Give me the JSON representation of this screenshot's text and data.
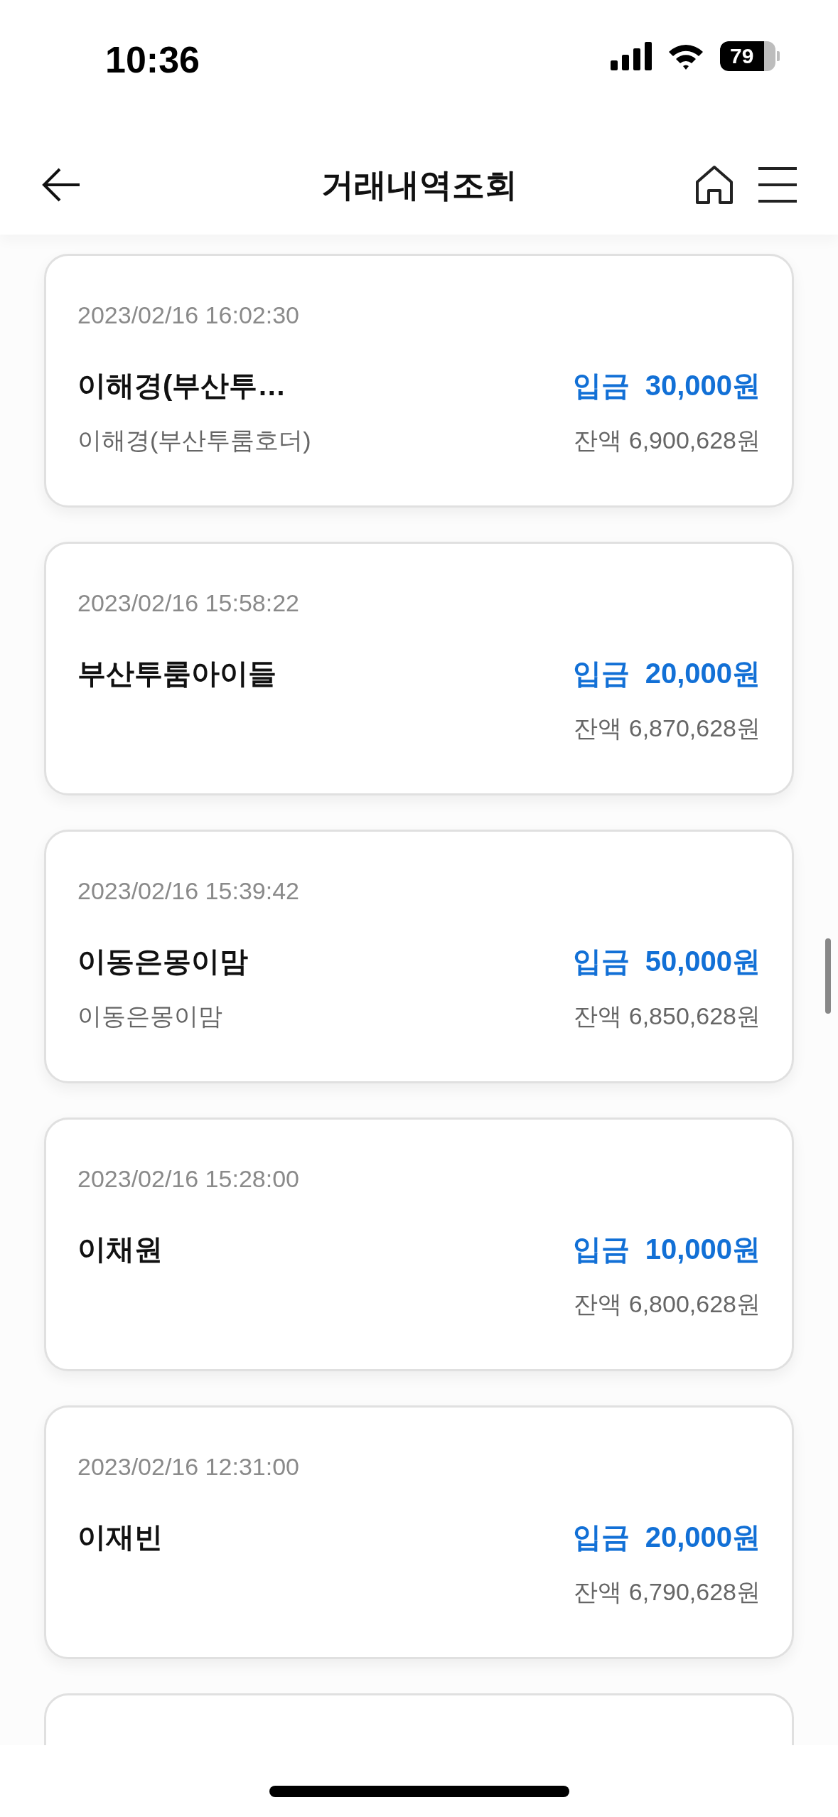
{
  "status_bar": {
    "time": "10:36",
    "battery": "79"
  },
  "header": {
    "title": "거래내역조회"
  },
  "transactions": [
    {
      "datetime": "2023/02/16 16:02:30",
      "name": "이해경(부산투…",
      "type": "입금",
      "amount": "30,000원",
      "memo": "이해경(부산투룸호더)",
      "balance": "잔액 6,900,628원"
    },
    {
      "datetime": "2023/02/16 15:58:22",
      "name": "부산투룸아이들",
      "type": "입금",
      "amount": "20,000원",
      "balance": "잔액 6,870,628원"
    },
    {
      "datetime": "2023/02/16 15:39:42",
      "name": "이동은몽이맘",
      "type": "입금",
      "amount": "50,000원",
      "memo": "이동은몽이맘",
      "balance": "잔액 6,850,628원"
    },
    {
      "datetime": "2023/02/16 15:28:00",
      "name": "이채원",
      "type": "입금",
      "amount": "10,000원",
      "balance": "잔액 6,800,628원"
    },
    {
      "datetime": "2023/02/16 12:31:00",
      "name": "이재빈",
      "type": "입금",
      "amount": "20,000원",
      "balance": "잔액 6,790,628원"
    }
  ]
}
